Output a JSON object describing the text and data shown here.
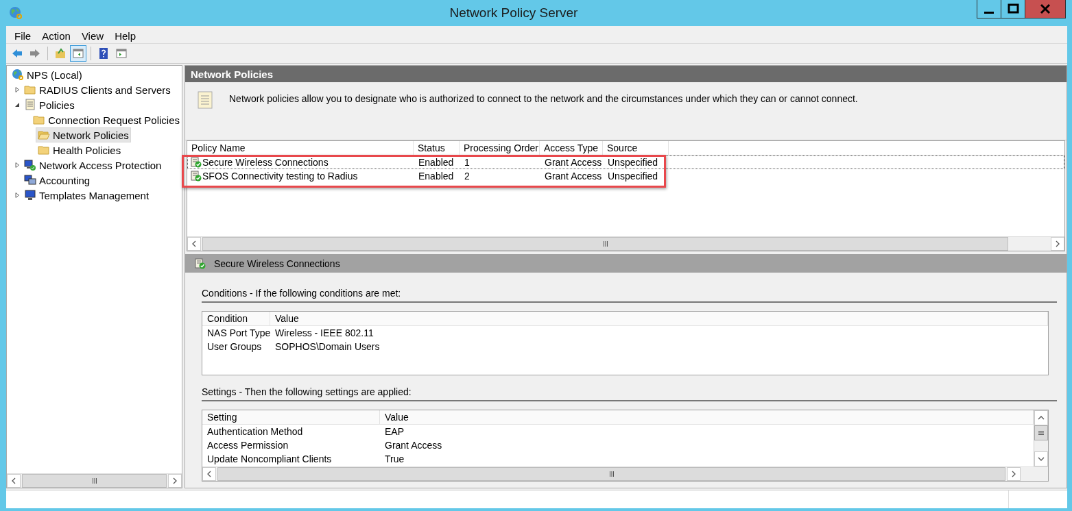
{
  "window": {
    "title": "Network Policy Server"
  },
  "menu": [
    "File",
    "Action",
    "View",
    "Help"
  ],
  "toolbar": [
    {
      "on": false
    },
    {
      "on": false
    },
    {
      "on": false
    },
    {
      "on": true
    },
    {
      "on": false
    },
    {
      "on": false
    }
  ],
  "tree": [
    {
      "label": "NPS (Local)",
      "selected": false,
      "children": [
        {
          "label": "RADIUS Clients and Servers",
          "selected": false,
          "expanded": false
        },
        {
          "label": "Policies",
          "selected": false,
          "expanded": true,
          "children": [
            {
              "label": "Connection Request Policies",
              "selected": false
            },
            {
              "label": "Network Policies",
              "selected": true
            },
            {
              "label": "Health Policies",
              "selected": false
            }
          ]
        },
        {
          "label": "Network Access Protection",
          "selected": false,
          "expanded": false
        },
        {
          "label": "Accounting",
          "selected": false
        },
        {
          "label": "Templates Management",
          "selected": false,
          "expanded": false
        }
      ]
    }
  ],
  "panel": {
    "title": "Network Policies",
    "description": "Network policies allow you to designate who is authorized to connect to the network and the circumstances under which they can or cannot connect."
  },
  "policies": {
    "columns": [
      "Policy Name",
      "Status",
      "Processing Order",
      "Access Type",
      "Source"
    ],
    "rows": [
      {
        "cells": [
          "Secure Wireless Connections",
          "Enabled",
          "1",
          "Grant Access",
          "Unspecified"
        ],
        "selected": true
      },
      {
        "cells": [
          "SFOS Connectivity testing to Radius",
          "Enabled",
          "2",
          "Grant Access",
          "Unspecified"
        ],
        "selected": false
      }
    ]
  },
  "details": {
    "title": "Secure Wireless Connections",
    "conditions": {
      "heading": "Conditions - If the following conditions are met:",
      "columns": [
        "Condition",
        "Value"
      ],
      "rows": [
        [
          "NAS Port Type",
          "Wireless - IEEE 802.11"
        ],
        [
          "User Groups",
          "SOPHOS\\Domain Users"
        ]
      ]
    },
    "settings": {
      "heading": "Settings - Then the following settings are applied:",
      "columns": [
        "Setting",
        "Value"
      ],
      "rows": [
        [
          "Authentication Method",
          "EAP"
        ],
        [
          "Access Permission",
          "Grant Access"
        ],
        [
          "Update Noncompliant Clients",
          "True"
        ]
      ]
    }
  }
}
